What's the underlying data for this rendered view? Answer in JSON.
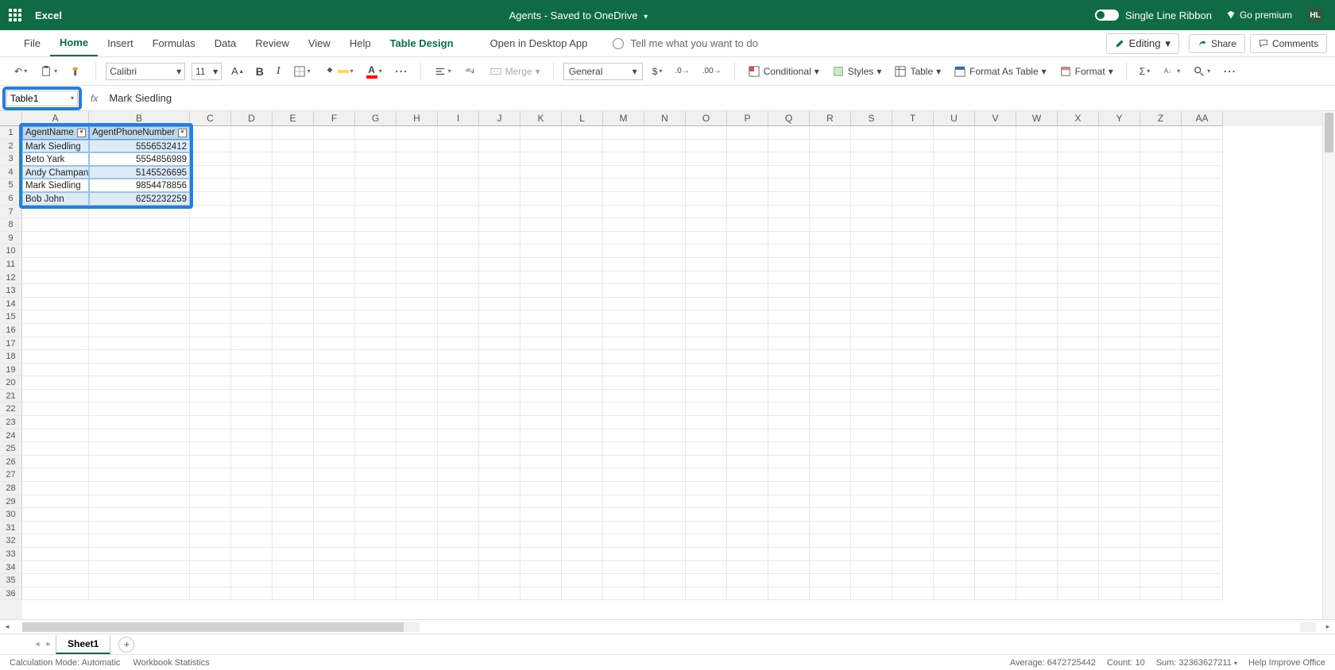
{
  "titlebar": {
    "app": "Excel",
    "doc": "Agents - Saved to OneDrive",
    "single_line": "Single Line Ribbon",
    "premium": "Go premium",
    "avatar": "HL"
  },
  "tabs": {
    "file": "File",
    "home": "Home",
    "insert": "Insert",
    "formulas": "Formulas",
    "data": "Data",
    "review": "Review",
    "view": "View",
    "help": "Help",
    "table_design": "Table Design",
    "open_desktop": "Open in Desktop App",
    "search_placeholder": "Tell me what you want to do",
    "editing": "Editing",
    "share": "Share",
    "comments": "Comments"
  },
  "ribbon": {
    "font_name": "Calibri",
    "font_size": "11",
    "merge": "Merge",
    "num_format": "General",
    "conditional": "Conditional",
    "styles": "Styles",
    "table": "Table",
    "format_as_table": "Format As Table",
    "format": "Format"
  },
  "namebox": "Table1",
  "formula": "Mark Siedling",
  "columns": [
    "A",
    "B",
    "C",
    "D",
    "E",
    "F",
    "G",
    "H",
    "I",
    "J",
    "K",
    "L",
    "M",
    "N",
    "O",
    "P",
    "Q",
    "R",
    "S",
    "T",
    "U",
    "V",
    "W",
    "X",
    "Y",
    "Z",
    "AA"
  ],
  "col_widths": {
    "A": 84,
    "B": 127,
    "rest": 52
  },
  "row_count": 36,
  "table": {
    "headers": [
      "AgentName",
      "AgentPhoneNumber"
    ],
    "rows": [
      [
        "Mark Siedling",
        "5556532412"
      ],
      [
        "Beto Yark",
        "5554856989"
      ],
      [
        "Andy Champan",
        "5145526695"
      ],
      [
        "Mark Siedling",
        "9854478856"
      ],
      [
        "Bob John",
        "6252232259"
      ]
    ]
  },
  "sheets": {
    "active": "Sheet1"
  },
  "status": {
    "calc": "Calculation Mode: Automatic",
    "wb_stats": "Workbook Statistics",
    "avg": "Average: 6472725442",
    "count": "Count: 10",
    "sum": "Sum: 32363627211",
    "help": "Help Improve Office"
  }
}
